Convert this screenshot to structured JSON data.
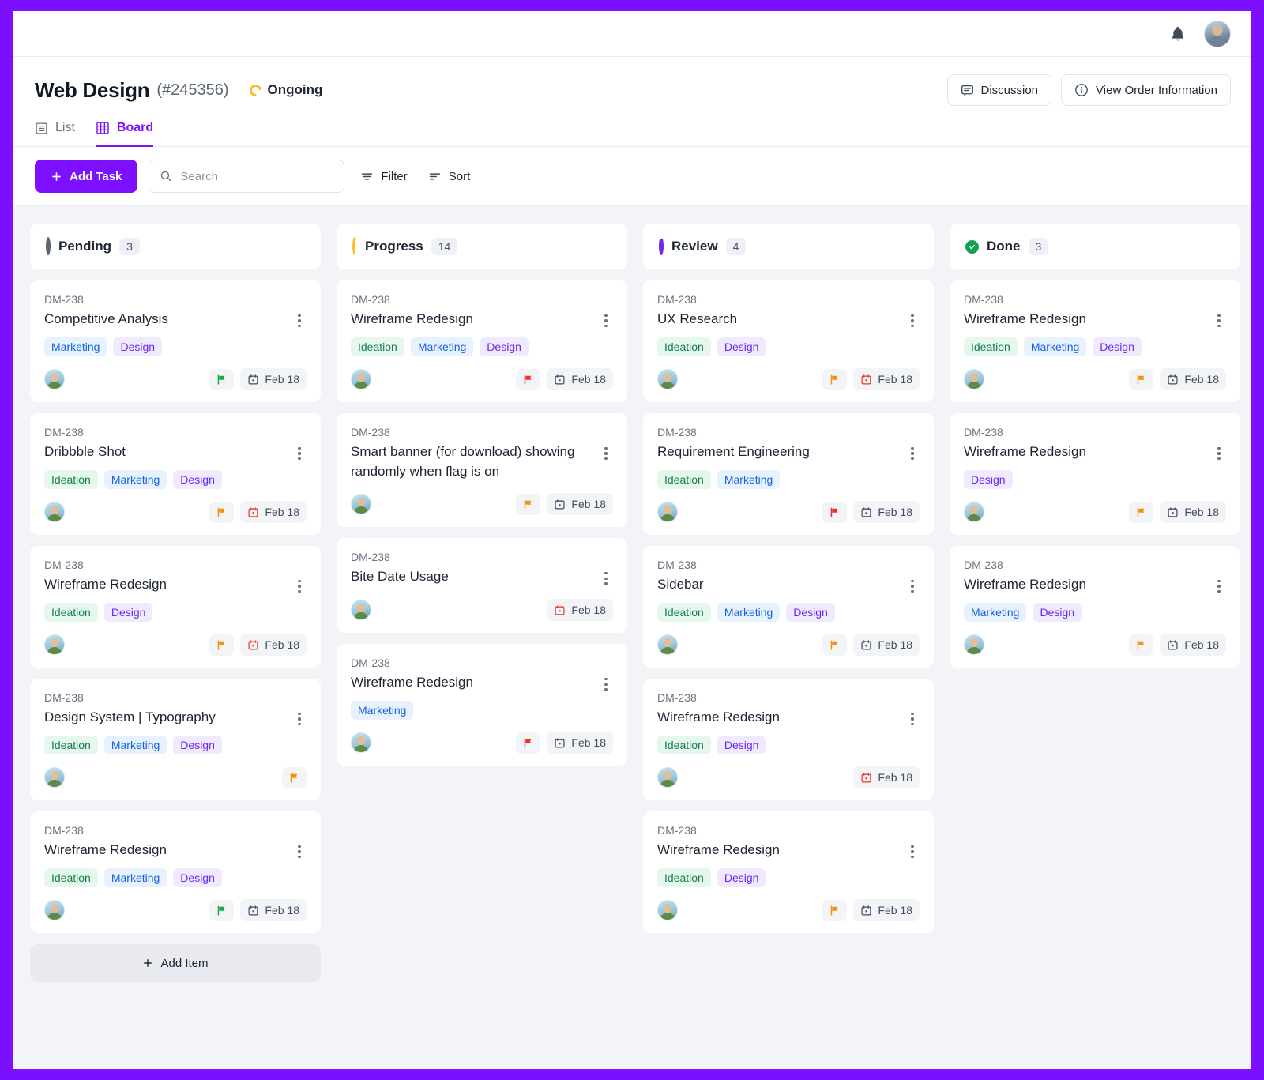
{
  "topbar": {
    "notifications_icon": "bell-icon",
    "avatar_icon": "user-avatar"
  },
  "header": {
    "project_title": "Web Design",
    "project_id": "(#245356)",
    "status_label": "Ongoing",
    "status_icon": "ongoing-ring-icon",
    "status_color": "#fbbf24",
    "actions": [
      {
        "label": "Discussion",
        "icon": "comment-icon"
      },
      {
        "label": "View Order Information",
        "icon": "info-icon"
      }
    ]
  },
  "tabs": [
    {
      "label": "List",
      "icon": "list-icon",
      "active": false
    },
    {
      "label": "Board",
      "icon": "grid-icon",
      "active": true
    }
  ],
  "toolbar": {
    "add_task_label": "Add Task",
    "search_placeholder": "Search",
    "search_value": "",
    "filter_label": "Filter",
    "sort_label": "Sort",
    "accent_color": "#7c10ff"
  },
  "board": {
    "add_item_label": "Add Item",
    "columns": [
      {
        "name": "Pending",
        "count": "3",
        "icon": "pending-ring-icon",
        "icon_color": "#5b6574",
        "show_add_item": true,
        "cards": [
          {
            "key": "DM-238",
            "title": "Competitive Analysis",
            "tags": [
              "Marketing",
              "Design"
            ],
            "flag": "green",
            "date": "Feb 18",
            "date_style": "dark"
          },
          {
            "key": "DM-238",
            "title": "Dribbble Shot",
            "tags": [
              "Ideation",
              "Marketing",
              "Design"
            ],
            "flag": "orange",
            "date": "Feb 18",
            "date_style": "red"
          },
          {
            "key": "DM-238",
            "title": "Wireframe Redesign",
            "tags": [
              "Ideation",
              "Design"
            ],
            "flag": "orange",
            "date": "Feb 18",
            "date_style": "red"
          },
          {
            "key": "DM-238",
            "title": "Design System | Typography",
            "tags": [
              "Ideation",
              "Marketing",
              "Design"
            ],
            "flag": "orange",
            "date": null,
            "date_style": null
          },
          {
            "key": "DM-238",
            "title": "Wireframe Redesign",
            "tags": [
              "Ideation",
              "Marketing",
              "Design"
            ],
            "flag": "green",
            "date": "Feb 18",
            "date_style": "dark"
          }
        ]
      },
      {
        "name": "Progress",
        "count": "14",
        "icon": "progress-ring-icon",
        "icon_color": "#fbbf24",
        "show_add_item": false,
        "cards": [
          {
            "key": "DM-238",
            "title": "Wireframe Redesign",
            "tags": [
              "Ideation",
              "Marketing",
              "Design"
            ],
            "flag": "red",
            "date": "Feb 18",
            "date_style": "dark"
          },
          {
            "key": "DM-238",
            "title": "Smart banner (for download) showing randomly when flag is on",
            "tags": [],
            "flag": "orange",
            "date": "Feb 18",
            "date_style": "dark"
          },
          {
            "key": "DM-238",
            "title": "Bite Date Usage",
            "tags": [],
            "flag": null,
            "date": "Feb 18",
            "date_style": "red"
          },
          {
            "key": "DM-238",
            "title": "Wireframe Redesign",
            "tags": [
              "Marketing"
            ],
            "flag": "red",
            "date": "Feb 18",
            "date_style": "dark"
          }
        ]
      },
      {
        "name": "Review",
        "count": "4",
        "icon": "review-ring-icon",
        "icon_color": "#6d28f5",
        "show_add_item": false,
        "cards": [
          {
            "key": "DM-238",
            "title": "UX Research",
            "tags": [
              "Ideation",
              "Design"
            ],
            "flag": "orange",
            "date": "Feb 18",
            "date_style": "red"
          },
          {
            "key": "DM-238",
            "title": "Requirement Engineering",
            "tags": [
              "Ideation",
              "Marketing"
            ],
            "flag": "red",
            "date": "Feb 18",
            "date_style": "dark"
          },
          {
            "key": "DM-238",
            "title": "Sidebar",
            "tags": [
              "Ideation",
              "Marketing",
              "Design"
            ],
            "flag": "orange",
            "date": "Feb 18",
            "date_style": "dark"
          },
          {
            "key": "DM-238",
            "title": "Wireframe Redesign",
            "tags": [
              "Ideation",
              "Design"
            ],
            "flag": null,
            "date": "Feb 18",
            "date_style": "red"
          },
          {
            "key": "DM-238",
            "title": "Wireframe Redesign",
            "tags": [
              "Ideation",
              "Design"
            ],
            "flag": "orange",
            "date": "Feb 18",
            "date_style": "dark"
          }
        ]
      },
      {
        "name": "Done",
        "count": "3",
        "icon": "done-check-icon",
        "icon_color": "#12a150",
        "show_add_item": false,
        "cards": [
          {
            "key": "DM-238",
            "title": "Wireframe Redesign",
            "tags": [
              "Ideation",
              "Marketing",
              "Design"
            ],
            "flag": "orange",
            "date": "Feb 18",
            "date_style": "dark"
          },
          {
            "key": "DM-238",
            "title": "Wireframe Redesign",
            "tags": [
              "Design"
            ],
            "flag": "orange",
            "date": "Feb 18",
            "date_style": "dark"
          },
          {
            "key": "DM-238",
            "title": "Wireframe Redesign",
            "tags": [
              "Marketing",
              "Design"
            ],
            "flag": "orange",
            "date": "Feb 18",
            "date_style": "dark"
          }
        ]
      }
    ]
  }
}
